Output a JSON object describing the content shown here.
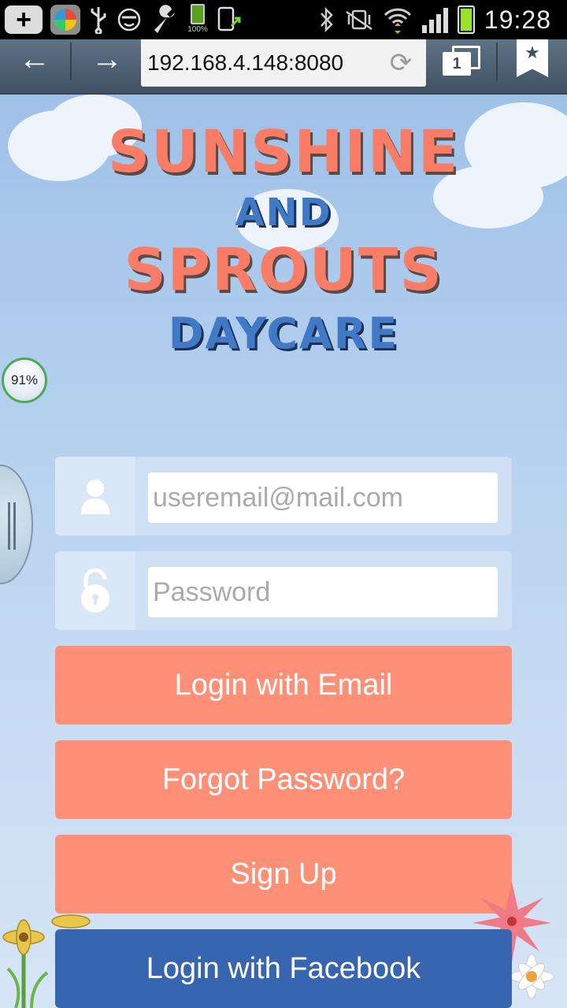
{
  "status_bar": {
    "battery_small_label": "100%",
    "time": "19:28"
  },
  "browser": {
    "back_label": "←",
    "forward_label": "→",
    "url": "192.168.4.148:8080",
    "tab_count": "1"
  },
  "overlay": {
    "badge_percent": "91%"
  },
  "logo": {
    "line1": "SUNSHINE",
    "line2": "AND",
    "line3": "SPROUTS",
    "line4": "DAYCARE"
  },
  "form": {
    "email_placeholder": "useremail@mail.com",
    "password_placeholder": "Password",
    "login_email_label": "Login with Email",
    "forgot_label": "Forgot Password?",
    "signup_label": "Sign Up",
    "facebook_label": "Login with Facebook"
  },
  "colors": {
    "primary_button": "#fe9078",
    "facebook_button": "#3765b0",
    "logo_coral": "#f97d66",
    "logo_blue": "#4179c6"
  }
}
